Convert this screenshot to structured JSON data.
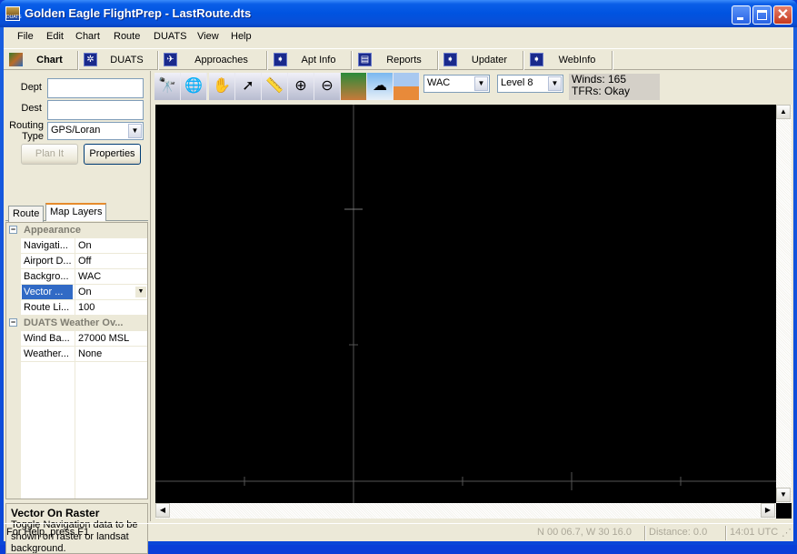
{
  "window": {
    "title": "Golden Eagle FlightPrep - LastRoute.dts",
    "app_icon_label": "DUATS",
    "controls": {
      "minimize": "minimize",
      "maximize": "maximize",
      "close": "✕"
    }
  },
  "menu": [
    "File",
    "Edit",
    "Chart",
    "Route",
    "DUATS",
    "View",
    "Help"
  ],
  "main_tabs": [
    {
      "label": "Chart",
      "icon": "map-icon",
      "active": true
    },
    {
      "label": "DUATS",
      "icon": "weather-icon",
      "active": false
    },
    {
      "label": "Approaches",
      "icon": "airplane-icon",
      "active": false
    },
    {
      "label": "Apt Info",
      "icon": "arrow-icon",
      "active": false
    },
    {
      "label": "Reports",
      "icon": "book-icon",
      "active": false
    },
    {
      "label": "Updater",
      "icon": "arrow-icon",
      "active": false
    },
    {
      "label": "WebInfo",
      "icon": "arrow-icon",
      "active": false
    }
  ],
  "route_form": {
    "dept_label": "Dept",
    "dept_value": "",
    "dest_label": "Dest",
    "dest_value": "",
    "routing_label_1": "Routing",
    "routing_label_2": "Type",
    "routing_value": "GPS/Loran",
    "plan_button": "Plan It",
    "properties_button": "Properties"
  },
  "panel_tabs": [
    {
      "label": "Route",
      "active": false
    },
    {
      "label": "Map Layers",
      "active": true
    }
  ],
  "property_grid": {
    "categories": [
      {
        "name": "Appearance",
        "rows": [
          {
            "name": "Navigati...",
            "value": "On"
          },
          {
            "name": "Airport D...",
            "value": "Off"
          },
          {
            "name": "Backgro...",
            "value": "WAC"
          },
          {
            "name": "Vector ...",
            "value": "On",
            "selected": true
          },
          {
            "name": "Route Li...",
            "value": "100"
          }
        ]
      },
      {
        "name": "DUATS Weather Ov...",
        "rows": [
          {
            "name": "Wind Ba...",
            "value": "27000 MSL"
          },
          {
            "name": "Weather...",
            "value": "None"
          }
        ]
      }
    ],
    "description_title": "Vector On Raster",
    "description_text": "Toggle Navigation data to be shown on raster or landsat background."
  },
  "toolbar": {
    "tools": [
      "binoculars-icon",
      "globe-icon",
      "pan-hand-icon",
      "select-pointer-icon",
      "measure-ruler-icon",
      "zoom-in-icon",
      "zoom-out-icon",
      "view-map-icon",
      "weather-cloud-icon",
      "profile-icon"
    ],
    "chart_type": "WAC",
    "zoom_level": "Level 8",
    "winds": "Winds: 165",
    "tfrs": "TFRs: Okay"
  },
  "statusbar": {
    "help": "For Help, press F1",
    "coords": "N 00 06.7,  W 30 16.0",
    "distance": "Distance: 0.0",
    "time": "14:01 UTC"
  }
}
